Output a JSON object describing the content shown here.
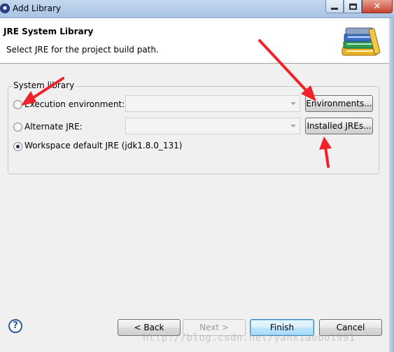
{
  "window": {
    "title": "Add Library"
  },
  "header": {
    "title": "JRE System Library",
    "description": "Select JRE for the project build path.",
    "icon": "library-books-icon"
  },
  "system_library": {
    "group_label": "System library",
    "options": [
      {
        "label": "Execution environment:",
        "checked": false,
        "combo_value": "",
        "enabled": false
      },
      {
        "label": "Alternate JRE:",
        "checked": false,
        "combo_value": "",
        "enabled": false
      },
      {
        "label": "Workspace default JRE (jdk1.8.0_131)",
        "checked": true
      }
    ],
    "environments_button": "Environments...",
    "installed_jres_button": "Installed JREs..."
  },
  "footer": {
    "help_icon": "help-icon",
    "help_glyph": "?",
    "back_label": "< Back",
    "next_label": "Next >",
    "finish_label": "Finish",
    "cancel_label": "Cancel"
  },
  "watermark": "http://blog.csdn.net/yanxiaobo1991",
  "colors": {
    "annotation_arrow": "#f0222a",
    "default_button": "#3c7fb1"
  }
}
